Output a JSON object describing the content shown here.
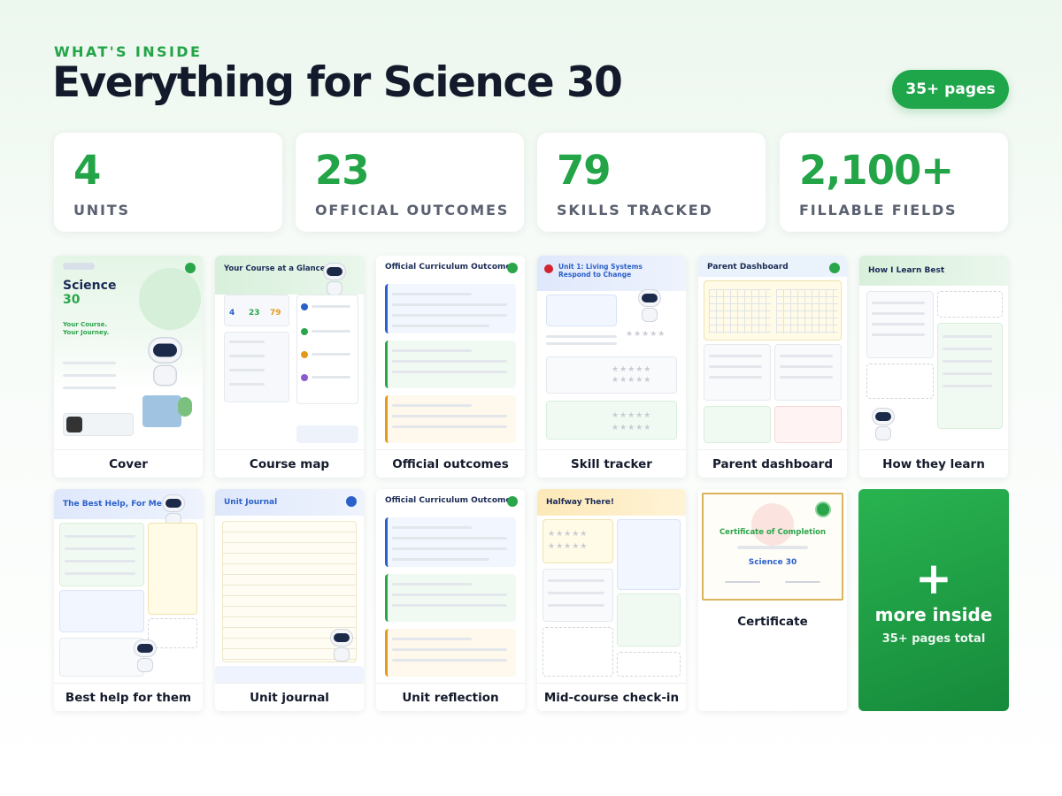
{
  "header": {
    "eyebrow": "WHAT'S INSIDE",
    "title": "Everything for Science 30",
    "pages_badge": "35+ pages"
  },
  "stats": [
    {
      "value": "4",
      "label": "UNITS"
    },
    {
      "value": "23",
      "label": "OFFICIAL OUTCOMES"
    },
    {
      "value": "79",
      "label": "SKILLS TRACKED"
    },
    {
      "value": "2,100+",
      "label": "FILLABLE FIELDS"
    }
  ],
  "pages": [
    {
      "label": "Cover"
    },
    {
      "label": "Course map"
    },
    {
      "label": "Official outcomes"
    },
    {
      "label": "Skill tracker"
    },
    {
      "label": "Parent dashboard"
    },
    {
      "label": "How they learn"
    },
    {
      "label": "Best help for them"
    },
    {
      "label": "Unit journal"
    },
    {
      "label": "Unit reflection"
    },
    {
      "label": "Mid-course check-in"
    },
    {
      "label": "Certificate"
    }
  ],
  "thumbs": {
    "cover_title": "Science",
    "cover_sub": "30",
    "cover_tag": "Your Course. Your Journey.",
    "course_map": "Your Course at a Glance",
    "outcomes": "Official Curriculum Outcomes",
    "skill": "Unit 1: Living Systems Respond to Change",
    "parent": "Parent Dashboard",
    "learn": "How I Learn Best",
    "help": "The Best Help, For Me",
    "journal": "Unit Journal",
    "halfway": "Halfway There!",
    "certificate": "Certificate of Completion",
    "cert_course": "Science 30"
  },
  "more": {
    "plus": "+",
    "title": "more inside",
    "subtitle": "35+ pages total"
  },
  "colors": {
    "accent": "#22a447",
    "ink": "#131a2b",
    "muted": "#5b6171"
  }
}
